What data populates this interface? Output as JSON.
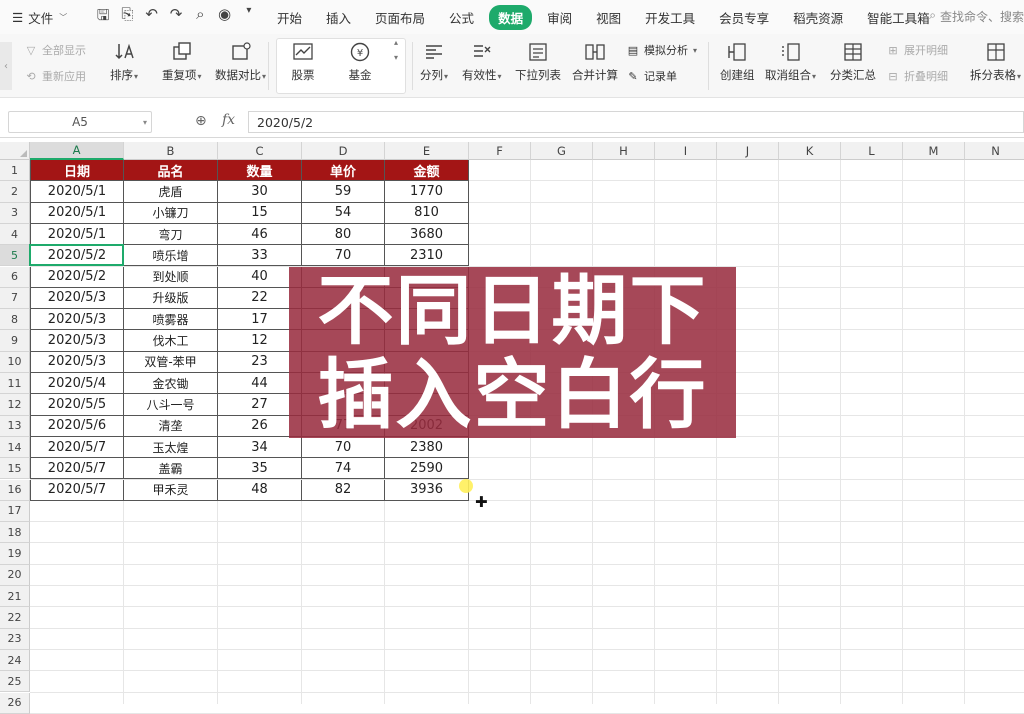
{
  "menubar": {
    "file_label": "文件",
    "tabs": [
      {
        "label": "开始",
        "active": false
      },
      {
        "label": "插入",
        "active": false
      },
      {
        "label": "页面布局",
        "active": false
      },
      {
        "label": "公式",
        "active": false
      },
      {
        "label": "数据",
        "active": true
      },
      {
        "label": "审阅",
        "active": false
      },
      {
        "label": "视图",
        "active": false
      },
      {
        "label": "开发工具",
        "active": false
      },
      {
        "label": "会员专享",
        "active": false
      },
      {
        "label": "稻壳资源",
        "active": false
      },
      {
        "label": "智能工具箱",
        "active": false
      }
    ],
    "search_text": "查找命令、搜索",
    "accent_color": "#1eaa6b"
  },
  "ribbon": {
    "show_all": "全部显示",
    "reapply": "重新应用",
    "sort": "排序",
    "duplicates": "重复项",
    "compare": "数据对比",
    "stock": "股票",
    "fund": "基金",
    "split_column": "分列",
    "validity": "有效性",
    "dropdown_list": "下拉列表",
    "merge_calc": "合并计算",
    "simulation": "模拟分析",
    "record": "记录单",
    "create_group": "创建组",
    "ungroup": "取消组合",
    "subtotal": "分类汇总",
    "expand_detail": "展开明细",
    "collapse_detail": "折叠明细",
    "split_table": "拆分表格"
  },
  "formula_bar": {
    "name_box": "A5",
    "formula": "2020/5/2"
  },
  "grid": {
    "columns": [
      "A",
      "B",
      "C",
      "D",
      "E",
      "F",
      "G",
      "H",
      "I",
      "J",
      "K",
      "L",
      "M",
      "N"
    ],
    "selected_column": "A",
    "selected_row": "5",
    "rows": [
      "1",
      "2",
      "3",
      "4",
      "5",
      "6",
      "7",
      "8",
      "9",
      "10",
      "11",
      "12",
      "13",
      "14",
      "15",
      "16",
      "17",
      "18",
      "19",
      "20",
      "21",
      "22",
      "23",
      "24",
      "25",
      "26"
    ]
  },
  "table": {
    "header_color": "#a31515",
    "headers": [
      "日期",
      "品名",
      "数量",
      "单价",
      "金额"
    ],
    "rows": [
      [
        "2020/5/1",
        "虎盾",
        "30",
        "59",
        "1770"
      ],
      [
        "2020/5/1",
        "小镰刀",
        "15",
        "54",
        "810"
      ],
      [
        "2020/5/1",
        "弯刀",
        "46",
        "80",
        "3680"
      ],
      [
        "2020/5/2",
        "喷乐增",
        "33",
        "70",
        "2310"
      ],
      [
        "2020/5/2",
        "到处顺",
        "40",
        "",
        ""
      ],
      [
        "2020/5/3",
        "升级版",
        "22",
        "",
        ""
      ],
      [
        "2020/5/3",
        "喷雾器",
        "17",
        "",
        ""
      ],
      [
        "2020/5/3",
        "伐木工",
        "12",
        "",
        ""
      ],
      [
        "2020/5/3",
        "双管-苯甲",
        "23",
        "",
        ""
      ],
      [
        "2020/5/4",
        "金农锄",
        "44",
        "",
        ""
      ],
      [
        "2020/5/5",
        "八斗一号",
        "27",
        "",
        ""
      ],
      [
        "2020/5/6",
        "清垄",
        "26",
        "77",
        "2002"
      ],
      [
        "2020/5/7",
        "玉太煌",
        "34",
        "70",
        "2380"
      ],
      [
        "2020/5/7",
        "盖霸",
        "35",
        "74",
        "2590"
      ],
      [
        "2020/5/7",
        "甲禾灵",
        "48",
        "82",
        "3936"
      ]
    ]
  },
  "overlay": {
    "line1": "不同日期下",
    "line2": "插入空白行",
    "color": "#982c3e"
  }
}
